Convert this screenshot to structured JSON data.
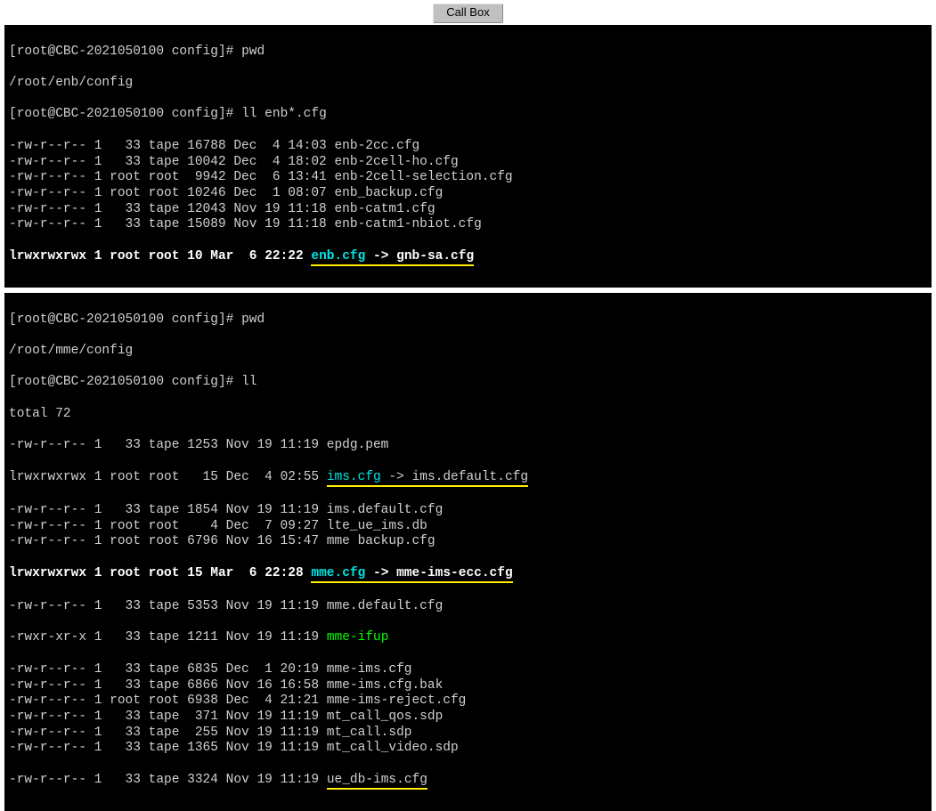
{
  "tab": {
    "label": "Call Box"
  },
  "panel1": {
    "host": "root@CBC-2021050100",
    "dir": "config",
    "cmd1": "pwd",
    "pwd_out": "/root/enb/config",
    "cmd2": "ll enb*.cfg",
    "rows": [
      {
        "perm": "-rw-r--r--",
        "ln": "1",
        "own": "  33",
        "grp": "tape",
        "size": "16788",
        "mon": "Dec",
        "day": " 4",
        "time": "14:03",
        "name": "enb-2cc.cfg"
      },
      {
        "perm": "-rw-r--r--",
        "ln": "1",
        "own": "  33",
        "grp": "tape",
        "size": "10042",
        "mon": "Dec",
        "day": " 4",
        "time": "18:02",
        "name": "enb-2cell-ho.cfg"
      },
      {
        "perm": "-rw-r--r--",
        "ln": "1",
        "own": "root",
        "grp": "root",
        "size": " 9942",
        "mon": "Dec",
        "day": " 6",
        "time": "13:41",
        "name": "enb-2cell-selection.cfg"
      },
      {
        "perm": "-rw-r--r--",
        "ln": "1",
        "own": "root",
        "grp": "root",
        "size": "10246",
        "mon": "Dec",
        "day": " 1",
        "time": "08:07",
        "name": "enb_backup.cfg"
      },
      {
        "perm": "-rw-r--r--",
        "ln": "1",
        "own": "  33",
        "grp": "tape",
        "size": "12043",
        "mon": "Nov",
        "day": "19",
        "time": "11:18",
        "name": "enb-catm1.cfg"
      },
      {
        "perm": "-rw-r--r--",
        "ln": "1",
        "own": "  33",
        "grp": "tape",
        "size": "15089",
        "mon": "Nov",
        "day": "19",
        "time": "11:18",
        "name": "enb-catm1-nbiot.cfg"
      }
    ],
    "link": {
      "perm": "lrwxrwxrwx",
      "ln": "1",
      "own": "root",
      "grp": "root",
      "size": "10",
      "mon": "Mar",
      "day": " 6",
      "time": "22:22",
      "name": "enb.cfg",
      "arrow": " -> ",
      "target": "gnb-sa.cfg"
    }
  },
  "panel2": {
    "host": "root@CBC-2021050100",
    "dir": "config",
    "cmd1": "pwd",
    "pwd_out": "/root/mme/config",
    "cmd2": "ll",
    "total": "total 72",
    "rows_a": [
      {
        "perm": "-rw-r--r--",
        "ln": "1",
        "own": "  33",
        "grp": "tape",
        "size": "1253",
        "mon": "Nov",
        "day": "19",
        "time": "11:19",
        "name": "epdg.pem"
      }
    ],
    "link1": {
      "perm": "lrwxrwxrwx",
      "ln": "1",
      "own": "root",
      "grp": "root",
      "size": "  15",
      "mon": "Dec",
      "day": " 4",
      "time": "02:55",
      "name": "ims.cfg",
      "arrow": " -> ",
      "target": "ims.default.cfg"
    },
    "rows_b": [
      {
        "perm": "-rw-r--r--",
        "ln": "1",
        "own": "  33",
        "grp": "tape",
        "size": "1854",
        "mon": "Nov",
        "day": "19",
        "time": "11:19",
        "name": "ims.default.cfg"
      },
      {
        "perm": "-rw-r--r--",
        "ln": "1",
        "own": "root",
        "grp": "root",
        "size": "   4",
        "mon": "Dec",
        "day": " 7",
        "time": "09:27",
        "name": "lte_ue_ims.db"
      },
      {
        "perm": "-rw-r--r--",
        "ln": "1",
        "own": "root",
        "grp": "root",
        "size": "6796",
        "mon": "Nov",
        "day": "16",
        "time": "15:47",
        "name": "mme backup.cfg"
      }
    ],
    "link2": {
      "perm": "lrwxrwxrwx",
      "ln": "1",
      "own": "root",
      "grp": "root",
      "size": "15",
      "mon": "Mar",
      "day": " 6",
      "time": "22:28",
      "name": "mme.cfg",
      "arrow": " -> ",
      "target": "mme-ims-ecc.cfg"
    },
    "rows_c": [
      {
        "perm": "-rw-r--r--",
        "ln": "1",
        "own": "  33",
        "grp": "tape",
        "size": "5353",
        "mon": "Nov",
        "day": "19",
        "time": "11:19",
        "name": "mme.default.cfg"
      }
    ],
    "exec_row": {
      "perm": "-rwxr-xr-x",
      "ln": "1",
      "own": "  33",
      "grp": "tape",
      "size": "1211",
      "mon": "Nov",
      "day": "19",
      "time": "11:19",
      "name": "mme-ifup"
    },
    "rows_d": [
      {
        "perm": "-rw-r--r--",
        "ln": "1",
        "own": "  33",
        "grp": "tape",
        "size": "6835",
        "mon": "Dec",
        "day": " 1",
        "time": "20:19",
        "name": "mme-ims.cfg"
      },
      {
        "perm": "-rw-r--r--",
        "ln": "1",
        "own": "  33",
        "grp": "tape",
        "size": "6866",
        "mon": "Nov",
        "day": "16",
        "time": "16:58",
        "name": "mme-ims.cfg.bak"
      },
      {
        "perm": "-rw-r--r--",
        "ln": "1",
        "own": "root",
        "grp": "root",
        "size": "6938",
        "mon": "Dec",
        "day": " 4",
        "time": "21:21",
        "name": "mme-ims-reject.cfg"
      },
      {
        "perm": "-rw-r--r--",
        "ln": "1",
        "own": "  33",
        "grp": "tape",
        "size": " 371",
        "mon": "Nov",
        "day": "19",
        "time": "11:19",
        "name": "mt_call_qos.sdp"
      },
      {
        "perm": "-rw-r--r--",
        "ln": "1",
        "own": "  33",
        "grp": "tape",
        "size": " 255",
        "mon": "Nov",
        "day": "19",
        "time": "11:19",
        "name": "mt_call.sdp"
      },
      {
        "perm": "-rw-r--r--",
        "ln": "1",
        "own": "  33",
        "grp": "tape",
        "size": "1365",
        "mon": "Nov",
        "day": "19",
        "time": "11:19",
        "name": "mt_call_video.sdp"
      }
    ],
    "last_row": {
      "perm": "-rw-r--r--",
      "ln": "1",
      "own": "  33",
      "grp": "tape",
      "size": "3324",
      "mon": "Nov",
      "day": "19",
      "time": "11:19",
      "name": "ue_db-ims.cfg"
    }
  }
}
